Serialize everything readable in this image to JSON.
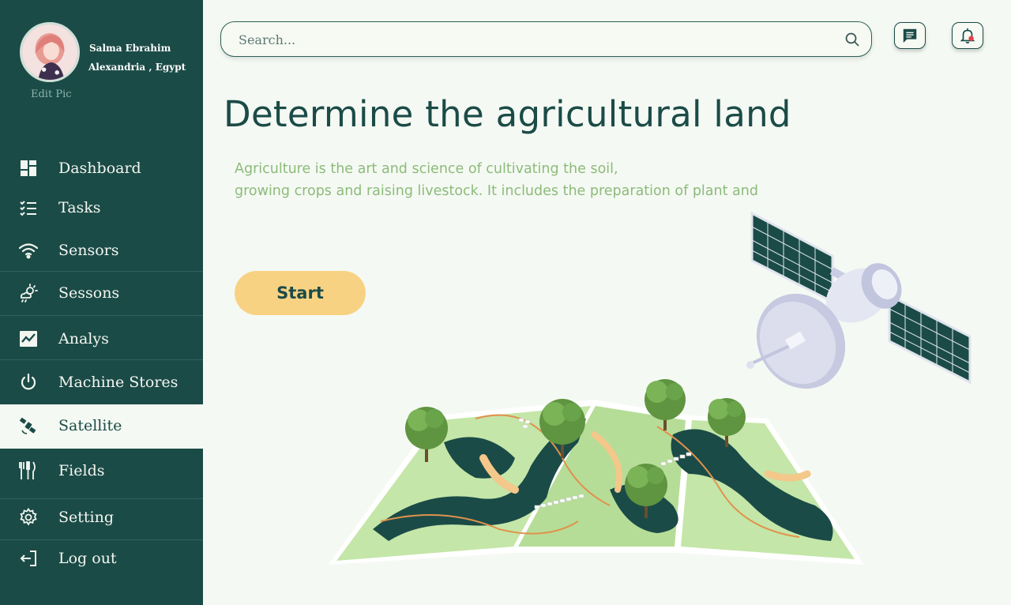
{
  "profile": {
    "name": "Salma Ebrahim",
    "location": "Alexandria , Egypt",
    "edit_label": "Edit Pic"
  },
  "sidebar": {
    "items": [
      {
        "label": "Dashboard",
        "icon": "dashboard-icon"
      },
      {
        "label": "Tasks",
        "icon": "checklist-icon"
      },
      {
        "label": "Sensors",
        "icon": "wifi-icon"
      },
      {
        "label": "Sessons",
        "icon": "weather-icon"
      },
      {
        "label": "Analys",
        "icon": "chart-icon"
      },
      {
        "label": "Machine Stores",
        "icon": "power-icon"
      },
      {
        "label": "Satellite",
        "icon": "satellite-icon",
        "active": true
      },
      {
        "label": "Fields",
        "icon": "utensils-icon"
      },
      {
        "label": "Setting",
        "icon": "gear-icon"
      },
      {
        "label": "Log out",
        "icon": "logout-icon"
      }
    ]
  },
  "search": {
    "placeholder": "Search..."
  },
  "hero": {
    "title": "Determine the agricultural land",
    "description_line1": "Agriculture is the art and science of cultivating the soil,",
    "description_line2": "growing crops and raising livestock. It includes the preparation of plant and",
    "start_label": "Start"
  },
  "colors": {
    "sidebar": "#1b4b47",
    "background": "#f5f9f3",
    "accent_button": "#f8d283",
    "description": "#8cbb7a"
  }
}
